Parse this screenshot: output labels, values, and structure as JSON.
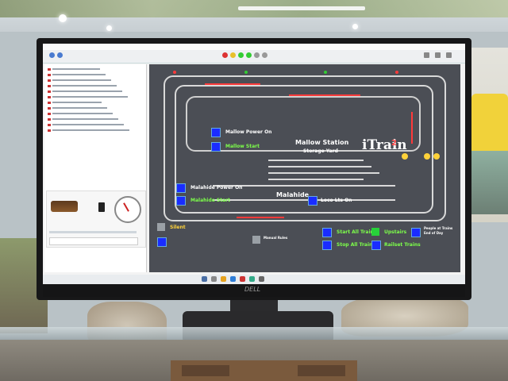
{
  "layout": {
    "mallow_station": "Mallow Station",
    "storage_yard": "Storage Yard",
    "malahide": "Malahide",
    "mallow_power_on": "Mallow Power On",
    "mallow_start": "Mallow Start",
    "malahide_power_on": "Malahide Power On",
    "malahide_start": "Malahide Start",
    "loco_lts_on": "Loco Lts On",
    "silent": "Silent",
    "start_all_trains": "Start All Trains",
    "stop_all_trains": "Stop All Trains",
    "upstairs": "Upstairs",
    "railset_trains": "Railset Trains",
    "people_at_trains": "People at Trains",
    "end_of_day": "End of Day",
    "manual_rules": "Manual Rules",
    "itrain_logo": "iTrain"
  },
  "colors": {
    "diagram_bg": "#4b4e55",
    "track": "#d9d9d9",
    "occupied": "#ff3a3a",
    "button_blue": "#1a2cff",
    "text_green": "#7dff4a",
    "text_yellow": "#ffd23a"
  },
  "icons": [
    "monitor-stand",
    "gauge-icon",
    "locomotive-icon",
    "signal-lights"
  ]
}
